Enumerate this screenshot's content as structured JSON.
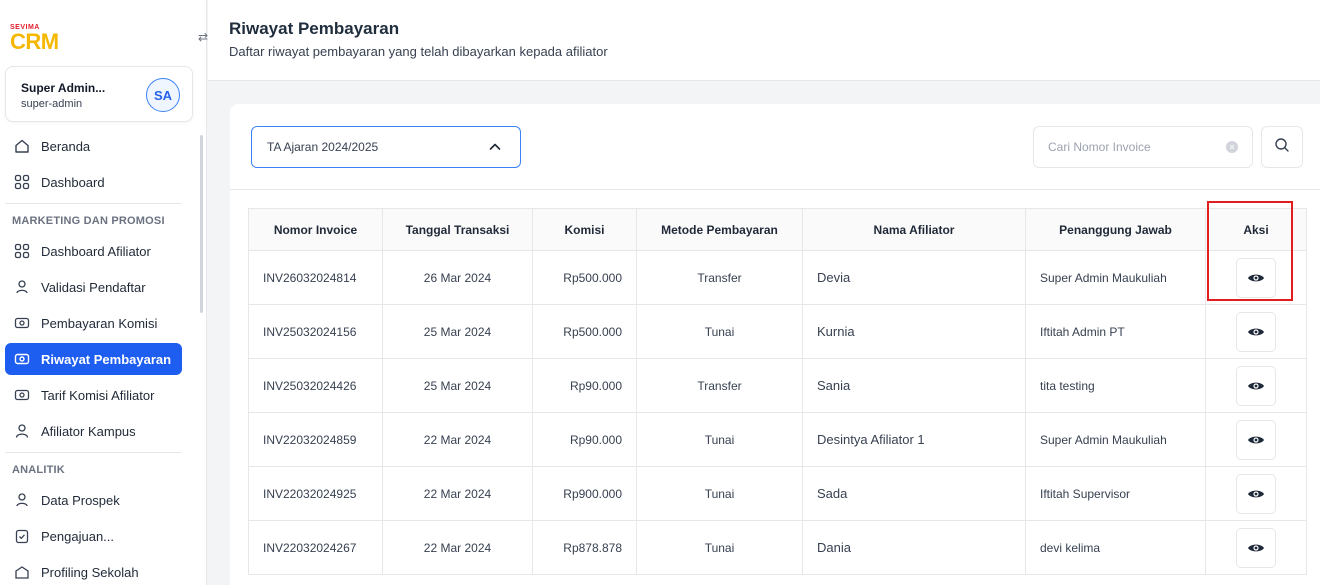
{
  "logo": {
    "small": "SEVIMA",
    "big": "CRM"
  },
  "user": {
    "name": "Super Admin...",
    "role": "super-admin",
    "initials": "SA"
  },
  "nav": {
    "beranda": "Beranda",
    "dashboard": "Dashboard",
    "section_marketing": "MARKETING DAN PROMOSI",
    "dashboard_afiliator": "Dashboard Afiliator",
    "validasi_pendaftar": "Validasi Pendaftar",
    "pembayaran_komisi": "Pembayaran Komisi",
    "riwayat_pembayaran": "Riwayat Pembayaran",
    "tarif_komisi": "Tarif Komisi Afiliator",
    "afiliator_kampus": "Afiliator Kampus",
    "section_analitik": "ANALITIK",
    "data_prospek": "Data Prospek",
    "pengajuan": "Pengajuan...",
    "profiling": "Profiling Sekolah"
  },
  "header": {
    "title": "Riwayat Pembayaran",
    "subtitle": "Daftar riwayat pembayaran yang telah dibayarkan kepada afiliator"
  },
  "filter": {
    "selected_year": "TA Ajaran 2024/2025",
    "search_placeholder": "Cari Nomor Invoice"
  },
  "table": {
    "headers": [
      "Nomor Invoice",
      "Tanggal Transaksi",
      "Komisi",
      "Metode Pembayaran",
      "Nama Afiliator",
      "Penanggung Jawab",
      "Aksi"
    ],
    "rows": [
      {
        "invoice": "INV26032024814",
        "date": "26 Mar 2024",
        "komisi": "Rp500.000",
        "metode": "Transfer",
        "afiliator": "Devia",
        "pj": "Super Admin Maukuliah"
      },
      {
        "invoice": "INV25032024156",
        "date": "25 Mar 2024",
        "komisi": "Rp500.000",
        "metode": "Tunai",
        "afiliator": "Kurnia",
        "pj": "Iftitah Admin PT"
      },
      {
        "invoice": "INV25032024426",
        "date": "25 Mar 2024",
        "komisi": "Rp90.000",
        "metode": "Transfer",
        "afiliator": "Sania",
        "pj": "tita testing"
      },
      {
        "invoice": "INV22032024859",
        "date": "22 Mar 2024",
        "komisi": "Rp90.000",
        "metode": "Tunai",
        "afiliator": "Desintya Afiliator 1",
        "pj": "Super Admin Maukuliah"
      },
      {
        "invoice": "INV22032024925",
        "date": "22 Mar 2024",
        "komisi": "Rp900.000",
        "metode": "Tunai",
        "afiliator": "Sada",
        "pj": "Iftitah Supervisor"
      },
      {
        "invoice": "INV22032024267",
        "date": "22 Mar 2024",
        "komisi": "Rp878.878",
        "metode": "Tunai",
        "afiliator": "Dania",
        "pj": "devi kelima"
      }
    ]
  },
  "colors": {
    "primary": "#1d5df0",
    "highlight": "#e11d1d",
    "logo_yellow": "#f5b700",
    "logo_red": "#e11d2a"
  }
}
